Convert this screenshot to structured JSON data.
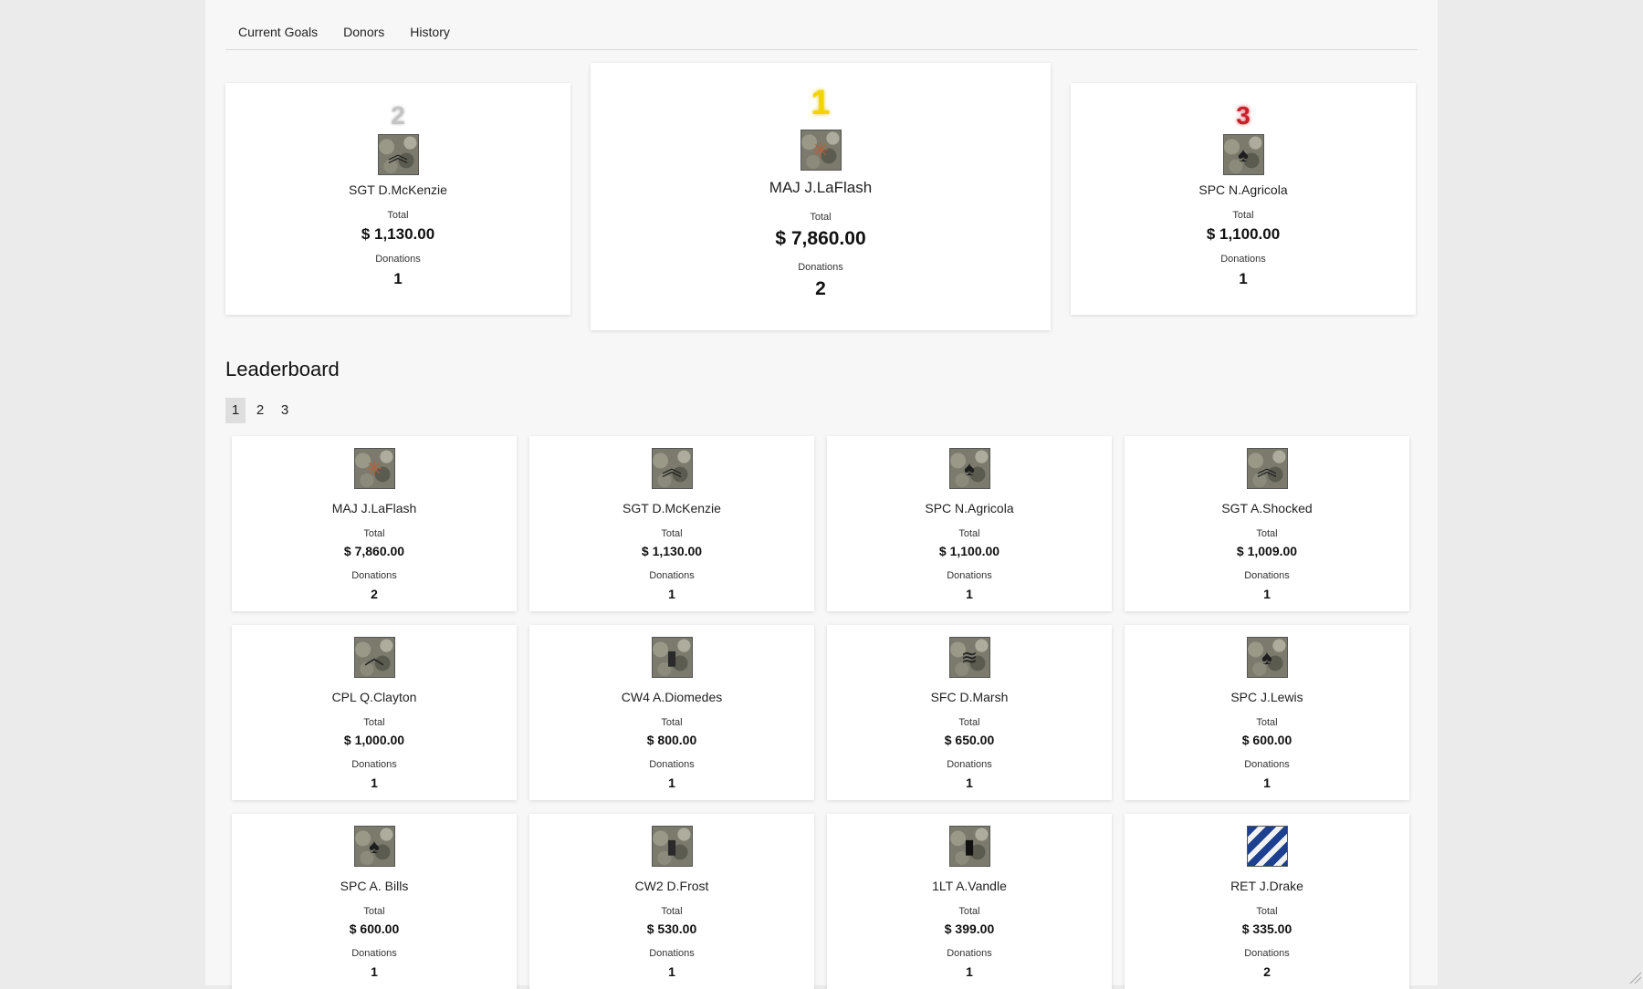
{
  "tabs": [
    "Current Goals",
    "Donors",
    "History"
  ],
  "podium": {
    "second": {
      "place": "2",
      "place_color": "#bdbdbd",
      "name": "SGT D.McKenzie",
      "total_label": "Total",
      "total": "$ 1,130.00",
      "donations_label": "Donations",
      "donations": "1",
      "badge_icon": "sergeant-chevron-icon"
    },
    "first": {
      "place": "1",
      "place_color": "#f2d400",
      "name": "MAJ J.LaFlash",
      "total_label": "Total",
      "total": "$ 7,860.00",
      "donations_label": "Donations",
      "donations": "2",
      "badge_icon": "major-oak-leaf-icon"
    },
    "third": {
      "place": "3",
      "place_color": "#c8202a",
      "name": "SPC N.Agricola",
      "total_label": "Total",
      "total": "$ 1,100.00",
      "donations_label": "Donations",
      "donations": "1",
      "badge_icon": "specialist-eagle-icon"
    }
  },
  "leaderboard": {
    "title": "Leaderboard",
    "pages": [
      "1",
      "2",
      "3"
    ],
    "active_page": "1",
    "total_label": "Total",
    "donations_label": "Donations",
    "entries": [
      {
        "name": "MAJ J.LaFlash",
        "total": "$ 7,860.00",
        "donations": "2",
        "badge_icon": "major-oak-leaf-icon"
      },
      {
        "name": "SGT D.McKenzie",
        "total": "$ 1,130.00",
        "donations": "1",
        "badge_icon": "sergeant-chevron-icon"
      },
      {
        "name": "SPC N.Agricola",
        "total": "$ 1,100.00",
        "donations": "1",
        "badge_icon": "specialist-eagle-icon"
      },
      {
        "name": "SGT A.Shocked",
        "total": "$ 1,009.00",
        "donations": "1",
        "badge_icon": "sergeant-chevron-icon"
      },
      {
        "name": "CPL Q.Clayton",
        "total": "$ 1,000.00",
        "donations": "1",
        "badge_icon": "corporal-chevron-icon"
      },
      {
        "name": "CW4 A.Diomedes",
        "total": "$ 800.00",
        "donations": "1",
        "badge_icon": "warrant-officer-bar-icon"
      },
      {
        "name": "SFC D.Marsh",
        "total": "$ 650.00",
        "donations": "1",
        "badge_icon": "sergeant-first-class-icon"
      },
      {
        "name": "SPC J.Lewis",
        "total": "$ 600.00",
        "donations": "1",
        "badge_icon": "specialist-eagle-icon"
      },
      {
        "name": "SPC A. Bills",
        "total": "$ 600.00",
        "donations": "1",
        "badge_icon": "specialist-eagle-icon"
      },
      {
        "name": "CW2 D.Frost",
        "total": "$ 530.00",
        "donations": "1",
        "badge_icon": "warrant-officer-bar-icon"
      },
      {
        "name": "1LT A.Vandle",
        "total": "$ 399.00",
        "donations": "1",
        "badge_icon": "lieutenant-bar-icon"
      },
      {
        "name": "RET J.Drake",
        "total": "$ 335.00",
        "donations": "2",
        "badge_icon": "retired-stripes-icon"
      }
    ]
  }
}
